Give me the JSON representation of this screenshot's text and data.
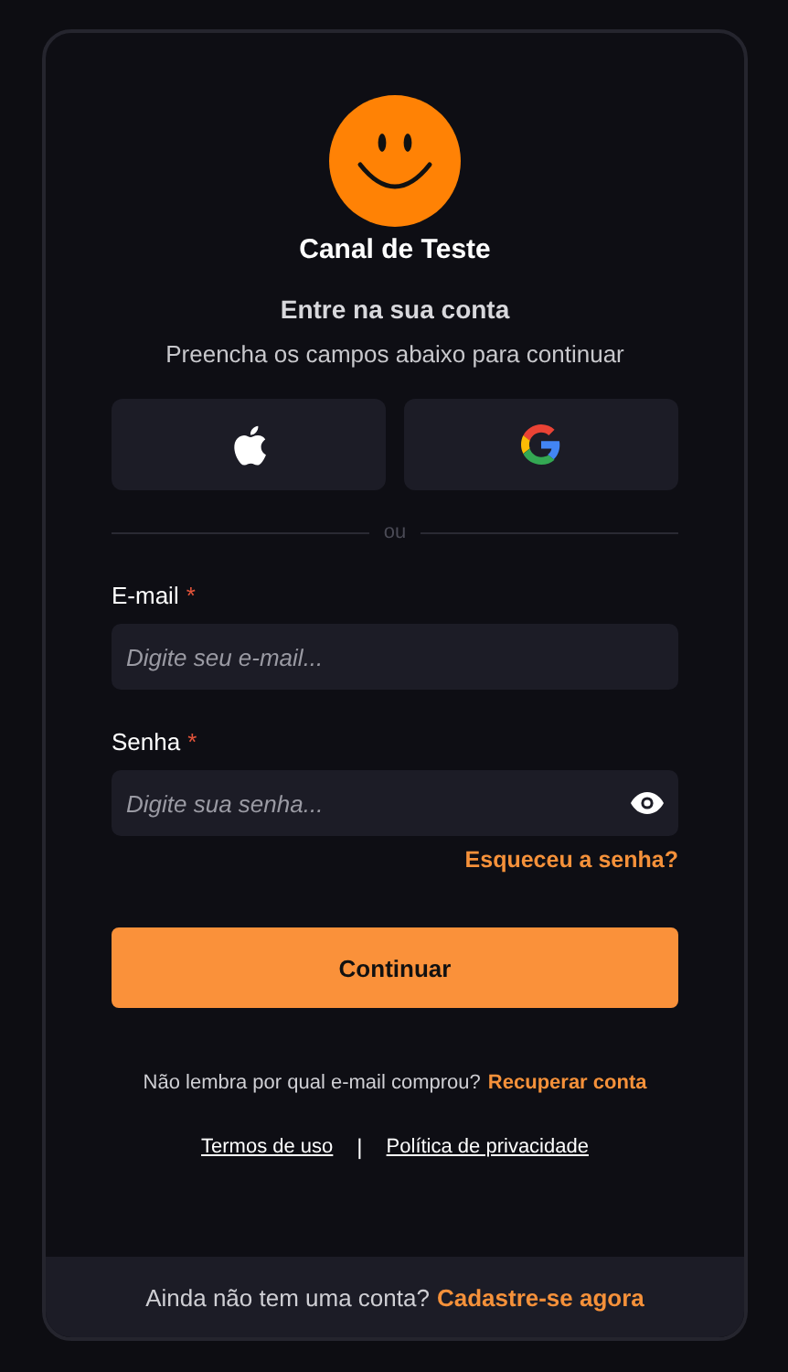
{
  "channel": {
    "name": "Canal de Teste"
  },
  "heading": "Entre na sua conta",
  "subheading": "Preencha os campos abaixo para continuar",
  "social_buttons": [
    {
      "kind": "apple"
    },
    {
      "kind": "google"
    }
  ],
  "divider_label": "ou",
  "fields": [
    {
      "kind": "email",
      "label": "E-mail",
      "required_mark": "*",
      "placeholder": "Digite seu e-mail..."
    },
    {
      "kind": "password",
      "label": "Senha",
      "required_mark": "*",
      "placeholder": "Digite sua senha..."
    }
  ],
  "forgot_link": "Esqueceu a senha?",
  "submit_button": "Continuar",
  "recovery": {
    "text": "Não lembra por qual e-mail comprou?",
    "link": "Recuperar conta"
  },
  "legal_links": [
    "Termos de uso",
    "Política de privacidade"
  ],
  "legal_separator": "|",
  "footer": {
    "text": "Ainda não tem uma conta?",
    "link": "Cadastre-se agora"
  }
}
